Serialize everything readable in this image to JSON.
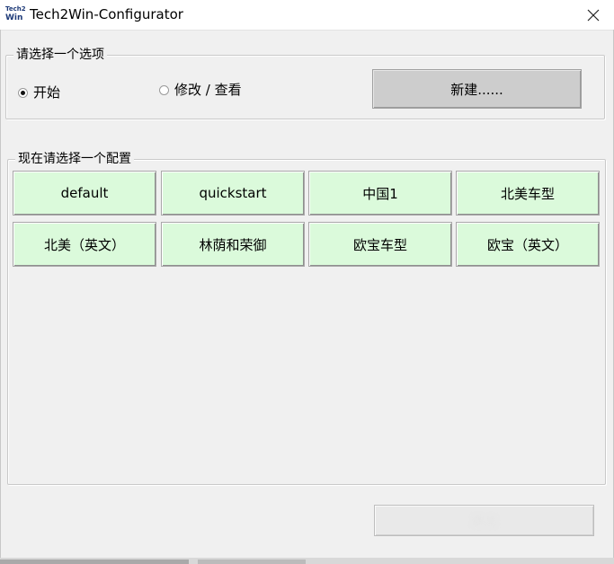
{
  "window": {
    "title": "Tech2Win-Configurator",
    "icon_text_top": "Tech2",
    "icon_text_bottom": "Win",
    "close_icon": "close-icon"
  },
  "mode_group": {
    "legend": "请选择一个选项",
    "radio_start": {
      "label": "开始",
      "checked": true
    },
    "radio_modify": {
      "label": "修改 / 查看",
      "checked": false
    },
    "new_button": "新建......"
  },
  "config_group": {
    "legend": "现在请选择一个配置",
    "buttons": [
      {
        "label": "default"
      },
      {
        "label": "quickstart"
      },
      {
        "label": "中国1"
      },
      {
        "label": "北美车型"
      },
      {
        "label": "北美（英文）"
      },
      {
        "label": "林荫和荣御"
      },
      {
        "label": "欧宝车型"
      },
      {
        "label": "欧宝（英文）"
      }
    ],
    "button_color": "#dbfadb"
  },
  "bottom_button": {
    "label": "退出"
  }
}
